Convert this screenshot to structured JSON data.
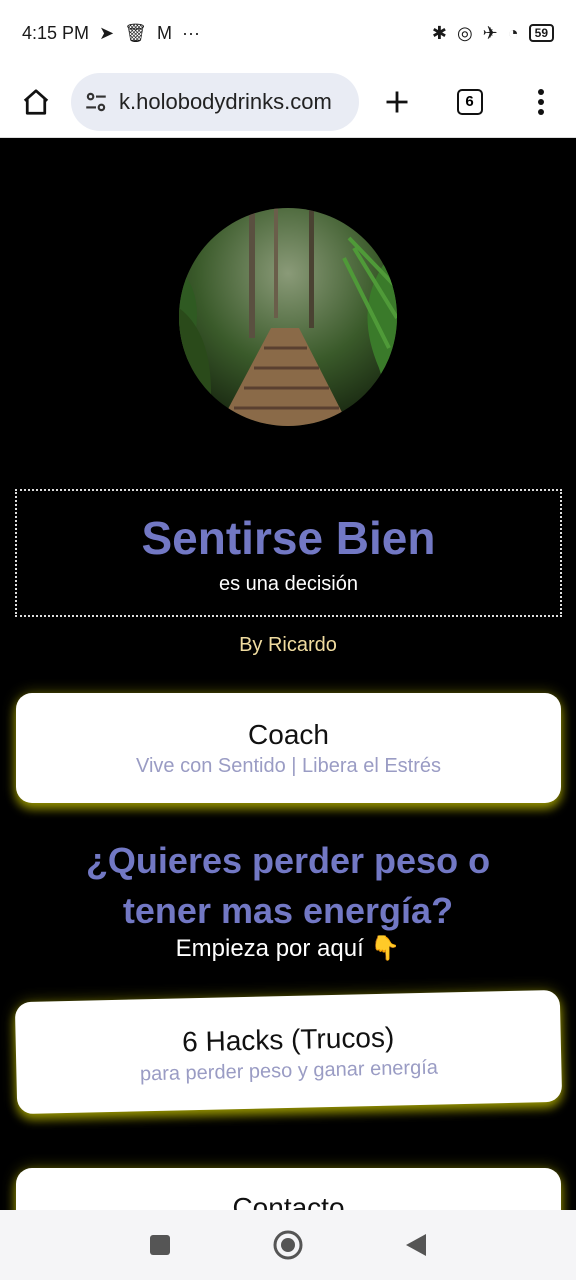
{
  "status": {
    "time": "4:15 PM",
    "battery": "59"
  },
  "browser": {
    "url": "k.holobodydrinks.com",
    "tab_count": "6"
  },
  "page": {
    "title": "Sentirse Bien",
    "subtitle": "es una decisión",
    "byline": "By Ricardo",
    "card1": {
      "title": "Coach",
      "subtitle": "Vive con Sentido | Libera el Estrés"
    },
    "headline_line1": "¿Quieres perder peso o",
    "headline_line2": "tener mas energía?",
    "cta": "Empieza por aquí 👇",
    "card2": {
      "title": "6 Hacks (Trucos)",
      "subtitle": "para perder peso y ganar energía"
    },
    "card3": {
      "title": "Contacto"
    }
  },
  "colors": {
    "accent": "#7278c4",
    "glow": "#e6e200",
    "byline": "#f0dca0"
  }
}
